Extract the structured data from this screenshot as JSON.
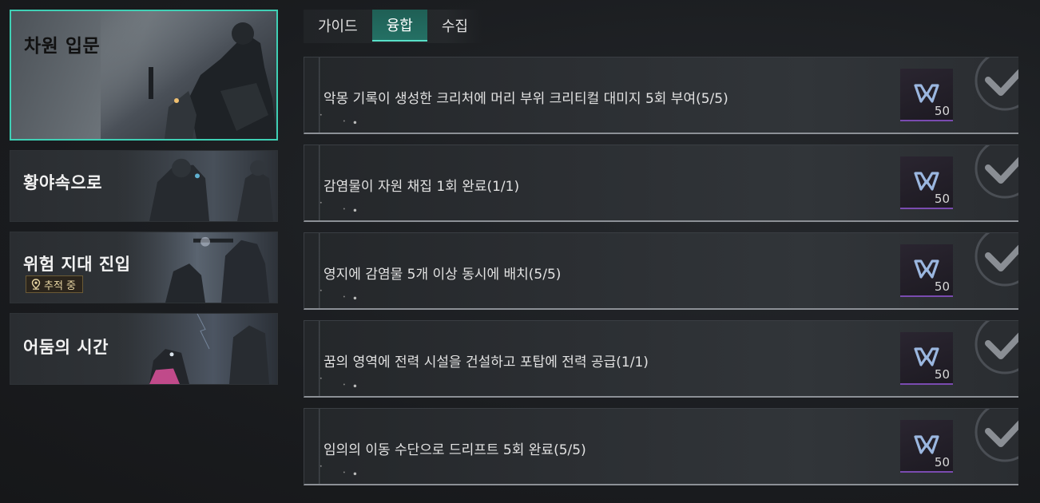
{
  "chapters": [
    {
      "title": "차원 입문",
      "selected": true
    },
    {
      "title": "황야속으로"
    },
    {
      "title": "위험 지대 진입",
      "badge": "추적 중"
    },
    {
      "title": "어둠의 시간"
    }
  ],
  "tabs": [
    {
      "label": "가이드"
    },
    {
      "label": "융합",
      "active": true
    },
    {
      "label": "수집"
    }
  ],
  "missions": [
    {
      "text": "악몽 기록이 생성한 크리처에 머리 부위 크리티컬 대미지 5회 부여(5/5)",
      "reward_qty": "50"
    },
    {
      "text": "감염물이 자원 채집 1회 완료(1/1)",
      "reward_qty": "50"
    },
    {
      "text": "영지에 감염물 5개 이상 동시에 배치(5/5)",
      "reward_qty": "50"
    },
    {
      "text": "꿈의 영역에 전력 시설을 건설하고 포탑에 전력 공급(1/1)",
      "reward_qty": "50"
    },
    {
      "text": "임의의 이동 수단으로 드리프트 5회 완료(5/5)",
      "reward_qty": "50"
    }
  ],
  "icons": {
    "reward": "m-token-icon",
    "claim": "checkmark-circle-icon",
    "badge": "location-pin-icon"
  },
  "colors": {
    "accent": "#3fd0b5",
    "tab_active": "#247064",
    "reward_rarity": "#7a4bb0",
    "badge_text": "#e8d6a3"
  }
}
